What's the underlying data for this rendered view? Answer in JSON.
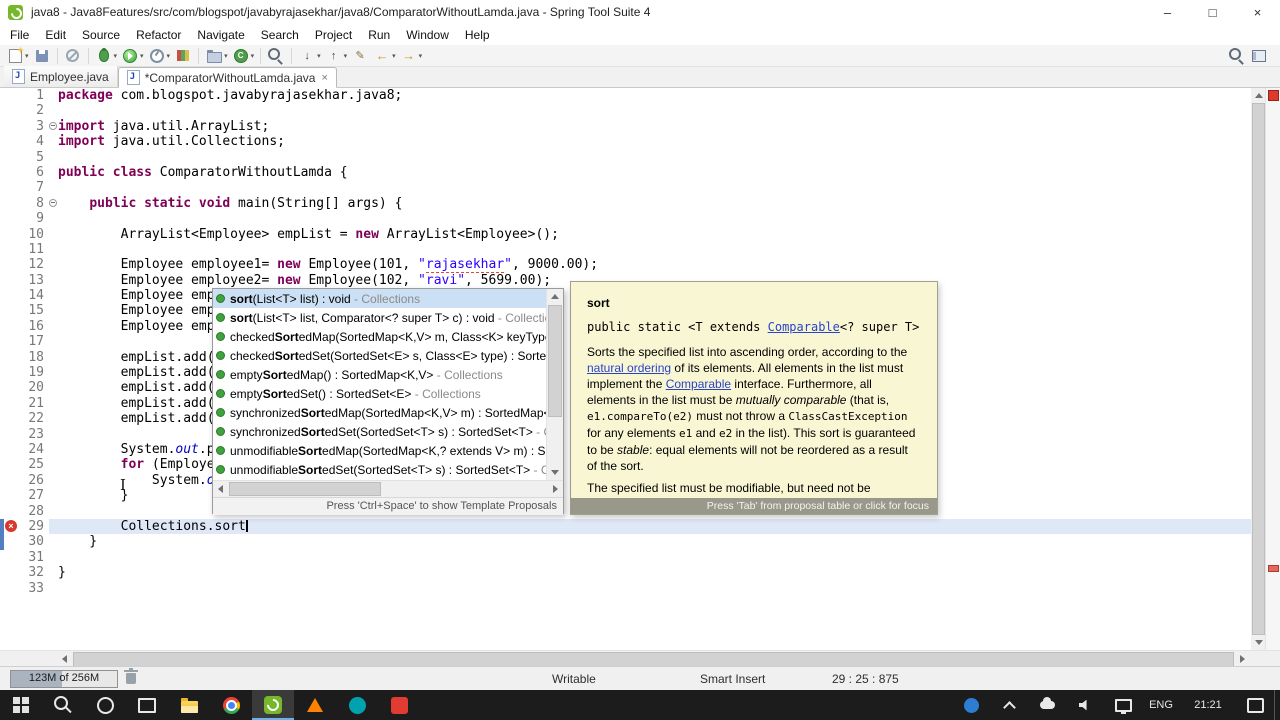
{
  "window": {
    "title": "java8 - Java8Features/src/com/blogspot/javabyrajasekhar/java8/ComparatorWithoutLamda.java - Spring Tool Suite 4",
    "controls": {
      "minimize": "–",
      "maximize": "□",
      "close": "×"
    }
  },
  "menu": [
    "File",
    "Edit",
    "Source",
    "Refactor",
    "Navigate",
    "Search",
    "Project",
    "Run",
    "Window",
    "Help"
  ],
  "toolbar": [
    {
      "name": "new-wizard",
      "dropdown": true
    },
    {
      "name": "save"
    },
    {
      "sep": true
    },
    {
      "name": "skip-all-breakpoints"
    },
    {
      "sep": true
    },
    {
      "name": "debug",
      "dropdown": true
    },
    {
      "name": "run",
      "dropdown": true
    },
    {
      "name": "profile",
      "dropdown": true
    },
    {
      "name": "coverage"
    },
    {
      "sep": true
    },
    {
      "name": "new-java-project",
      "dropdown": true
    },
    {
      "name": "new-java-class",
      "dropdown": true
    },
    {
      "sep": true
    },
    {
      "name": "search-flashlight"
    },
    {
      "sep": true
    },
    {
      "name": "next-annotation",
      "dropdown": true
    },
    {
      "name": "prev-annotation",
      "dropdown": true
    },
    {
      "name": "last-edit-location"
    },
    {
      "name": "back",
      "dropdown": true
    },
    {
      "name": "forward",
      "dropdown": true
    }
  ],
  "toolbar_right": [
    {
      "name": "search-dialog"
    },
    {
      "name": "open-perspective"
    }
  ],
  "tabs": [
    {
      "label": "Employee.java",
      "active": false
    },
    {
      "label": "*ComparatorWithoutLamda.java",
      "active": true,
      "close": "×"
    }
  ],
  "editor": {
    "current_line": 29,
    "error_line": 29,
    "caret_line": 29,
    "lines": [
      {
        "n": 1,
        "segs": [
          {
            "t": "package",
            "c": "k"
          },
          {
            "t": " com.blogspot.javabyrajasekhar.java8;",
            "c": "d"
          }
        ]
      },
      {
        "n": 2,
        "segs": []
      },
      {
        "n": 3,
        "fold": true,
        "segs": [
          {
            "t": "import",
            "c": "k"
          },
          {
            "t": " java.util.ArrayList;",
            "c": "d"
          }
        ]
      },
      {
        "n": 4,
        "segs": [
          {
            "t": "import",
            "c": "k"
          },
          {
            "t": " java.util.Collections;",
            "c": "d"
          }
        ]
      },
      {
        "n": 5,
        "segs": []
      },
      {
        "n": 6,
        "segs": [
          {
            "t": "public",
            "c": "k"
          },
          {
            "t": " ",
            "c": "d"
          },
          {
            "t": "class",
            "c": "k"
          },
          {
            "t": " ComparatorWithoutLamda {",
            "c": "d"
          }
        ]
      },
      {
        "n": 7,
        "segs": []
      },
      {
        "n": 8,
        "fold": true,
        "segs": [
          {
            "t": "    ",
            "c": "d"
          },
          {
            "t": "public",
            "c": "k"
          },
          {
            "t": " ",
            "c": "d"
          },
          {
            "t": "static",
            "c": "k"
          },
          {
            "t": " ",
            "c": "d"
          },
          {
            "t": "void",
            "c": "k"
          },
          {
            "t": " main(String[] args) {",
            "c": "d"
          }
        ]
      },
      {
        "n": 9,
        "segs": []
      },
      {
        "n": 10,
        "segs": [
          {
            "t": "        ArrayList<Employee> empList = ",
            "c": "d"
          },
          {
            "t": "new",
            "c": "k"
          },
          {
            "t": " ArrayList<Employee>();",
            "c": "d"
          }
        ]
      },
      {
        "n": 11,
        "segs": []
      },
      {
        "n": 12,
        "segs": [
          {
            "t": "        Employee employee1= ",
            "c": "d"
          },
          {
            "t": "new",
            "c": "k"
          },
          {
            "t": " Employee(101, ",
            "c": "d"
          },
          {
            "t": "\"",
            "c": "s"
          },
          {
            "t": "rajasekhar",
            "c": "s sp"
          },
          {
            "t": "\"",
            "c": "s"
          },
          {
            "t": ", 9000.00);",
            "c": "d"
          }
        ]
      },
      {
        "n": 13,
        "segs": [
          {
            "t": "        Employee employee2= ",
            "c": "d"
          },
          {
            "t": "new",
            "c": "k"
          },
          {
            "t": " Employee(102, ",
            "c": "d"
          },
          {
            "t": "\"",
            "c": "s"
          },
          {
            "t": "ravi",
            "c": "s sp"
          },
          {
            "t": "\"",
            "c": "s"
          },
          {
            "t": ", 5699.00);",
            "c": "d"
          }
        ]
      },
      {
        "n": 14,
        "segs": [
          {
            "t": "        Employee empl",
            "c": "d"
          }
        ]
      },
      {
        "n": 15,
        "segs": [
          {
            "t": "        Employee empl",
            "c": "d"
          }
        ]
      },
      {
        "n": 16,
        "segs": [
          {
            "t": "        Employee empl",
            "c": "d"
          }
        ]
      },
      {
        "n": 17,
        "segs": []
      },
      {
        "n": 18,
        "segs": [
          {
            "t": "        empList.add(e",
            "c": "d"
          }
        ]
      },
      {
        "n": 19,
        "segs": [
          {
            "t": "        empList.add(e",
            "c": "d"
          }
        ]
      },
      {
        "n": 20,
        "segs": [
          {
            "t": "        empList.add(e",
            "c": "d"
          }
        ]
      },
      {
        "n": 21,
        "segs": [
          {
            "t": "        empList.add(e",
            "c": "d"
          }
        ]
      },
      {
        "n": 22,
        "segs": [
          {
            "t": "        empList.add(e",
            "c": "d"
          }
        ]
      },
      {
        "n": 23,
        "segs": []
      },
      {
        "n": 24,
        "segs": [
          {
            "t": "        System.",
            "c": "d"
          },
          {
            "t": "out",
            "c": "o"
          },
          {
            "t": ".pr",
            "c": "d"
          }
        ]
      },
      {
        "n": 25,
        "segs": [
          {
            "t": "        ",
            "c": "d"
          },
          {
            "t": "for",
            "c": "k"
          },
          {
            "t": " (Employee",
            "c": "d"
          }
        ]
      },
      {
        "n": 26,
        "segs": [
          {
            "t": "            System.",
            "c": "d"
          },
          {
            "t": "ou",
            "c": "o"
          }
        ]
      },
      {
        "n": 27,
        "segs": [
          {
            "t": "        }",
            "c": "d"
          }
        ]
      },
      {
        "n": 28,
        "segs": []
      },
      {
        "n": 29,
        "segs": [
          {
            "t": "        Collections.sort",
            "c": "d"
          }
        ]
      },
      {
        "n": 30,
        "segs": [
          {
            "t": "    }",
            "c": "d"
          }
        ]
      },
      {
        "n": 31,
        "segs": []
      },
      {
        "n": 32,
        "segs": [
          {
            "t": "}",
            "c": "d"
          }
        ]
      },
      {
        "n": 33,
        "segs": []
      }
    ]
  },
  "autocomplete": {
    "items": [
      {
        "selected": true,
        "pre": "",
        "bold": "sort",
        "post": "(List<T> list) : void ",
        "qual": "- Collections"
      },
      {
        "pre": "",
        "bold": "sort",
        "post": "(List<T> list, Comparator<? super T> c) : void ",
        "qual": "- Collection"
      },
      {
        "pre": "checked",
        "bold": "Sort",
        "post": "edMap(SortedMap<K,V> m, Class<K> keyType, C",
        "qual": ""
      },
      {
        "pre": "checked",
        "bold": "Sort",
        "post": "edSet(SortedSet<E> s, Class<E> type) : SortedSe",
        "qual": ""
      },
      {
        "pre": "empty",
        "bold": "Sort",
        "post": "edMap() : SortedMap<K,V> ",
        "qual": "- Collections"
      },
      {
        "pre": "empty",
        "bold": "Sort",
        "post": "edSet() : SortedSet<E> ",
        "qual": "- Collections"
      },
      {
        "pre": "synchronized",
        "bold": "Sort",
        "post": "edMap(SortedMap<K,V> m) : SortedMap<K",
        "qual": ""
      },
      {
        "pre": "synchronized",
        "bold": "Sort",
        "post": "edSet(SortedSet<T> s) : SortedSet<T> ",
        "qual": "- Co"
      },
      {
        "pre": "unmodifiable",
        "bold": "Sort",
        "post": "edMap(SortedMap<K,? extends V> m) : Sor",
        "qual": ""
      },
      {
        "pre": "unmodifiable",
        "bold": "Sort",
        "post": "edSet(SortedSet<T> s) : SortedSet<T> ",
        "qual": "- Co"
      }
    ],
    "footer": "Press 'Ctrl+Space' to show Template Proposals"
  },
  "javadoc": {
    "title": "sort",
    "signature": [
      {
        "t": "public static <T extends "
      },
      {
        "t": "Comparable",
        "c": "link"
      },
      {
        "t": "<? super T>"
      }
    ],
    "body": [
      {
        "t": "Sorts the specified list into ascending order, according to the "
      },
      {
        "t": "natural ordering",
        "c": "link"
      },
      {
        "t": " of its elements. All elements in the list must implement the "
      },
      {
        "t": "Comparable",
        "c": "link"
      },
      {
        "t": " interface. Furthermore, all elements in the list must be "
      },
      {
        "t": "mutually comparable",
        "c": "i"
      },
      {
        "t": " (that is, "
      },
      {
        "t": "e1.compareTo(e2)",
        "c": "code"
      },
      {
        "t": " must not throw a "
      },
      {
        "t": "ClassCastException",
        "c": "code"
      },
      {
        "t": " for any elements "
      },
      {
        "t": "e1",
        "c": "code"
      },
      {
        "t": " and "
      },
      {
        "t": "e2",
        "c": "code"
      },
      {
        "t": " in the list). This sort is guaranteed to be "
      },
      {
        "t": "stable",
        "c": "i"
      },
      {
        "t": ": equal elements will not be reordered as a result of the sort."
      }
    ],
    "body2": [
      {
        "t": "The specified list must be modifiable, but need not be resizable."
      }
    ],
    "footer": "Press 'Tab' from proposal table or click for focus"
  },
  "statusbar": {
    "heap": "123M of 256M",
    "heap_fill_percent": 48,
    "writable": "Writable",
    "insert_mode": "Smart Insert",
    "position": "29 : 25 : 875"
  },
  "taskbar": {
    "apps": [
      {
        "name": "search"
      },
      {
        "name": "cortana"
      },
      {
        "name": "task-view"
      },
      {
        "name": "file-explorer"
      },
      {
        "name": "chrome"
      },
      {
        "name": "sts",
        "active": true
      },
      {
        "name": "vlc"
      },
      {
        "name": "teal-app"
      },
      {
        "name": "red-app"
      }
    ],
    "tray": [
      {
        "name": "bluetooth"
      },
      {
        "name": "hidden-icons"
      },
      {
        "name": "onedrive"
      },
      {
        "name": "speaker"
      },
      {
        "name": "network"
      }
    ],
    "language": "ENG",
    "time": "21:21"
  }
}
